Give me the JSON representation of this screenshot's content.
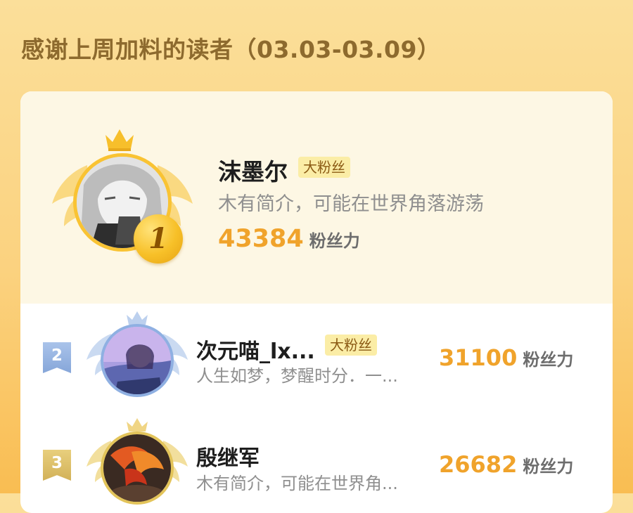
{
  "header": {
    "title": "感谢上周加料的读者（03.03-03.09）"
  },
  "leaderboard": [
    {
      "rank": "1",
      "name": "沫墨尔",
      "badge": "大粉丝",
      "bio": "木有简介，可能在世界角落游荡",
      "score": "43384",
      "score_unit": "粉丝力"
    },
    {
      "rank": "2",
      "name": "次元喵_lx...",
      "badge": "大粉丝",
      "bio": "人生如梦，梦醒时分．一...",
      "score": "31100",
      "score_unit": "粉丝力"
    },
    {
      "rank": "3",
      "name": "殷继军",
      "badge": "",
      "bio": "木有简介，可能在世界角...",
      "score": "26682",
      "score_unit": "粉丝力"
    }
  ],
  "colors": {
    "gold": "#f9c333",
    "score": "#f0a32b",
    "silver": "#86a6d9",
    "bronze": "#d2b158"
  },
  "icons": {
    "crown": "crown-icon",
    "wings": "wings-icon",
    "medal": "gold-medal-icon"
  }
}
